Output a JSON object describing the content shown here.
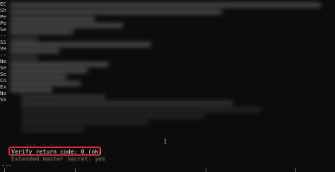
{
  "left_prefixes": [
    "EC",
    "Sh",
    "Pe",
    "Pe",
    "Se",
    "--",
    "SS",
    "Ve",
    "--",
    "Ne",
    "Se",
    "Se",
    "Co",
    "Ex",
    "No",
    "SS"
  ],
  "bottom_lines": {
    "faded_above": "    ---  · · ·  ",
    "verify": "Verify return code: 0 (ok)",
    "faded_below": "Extended master secret: yes"
  },
  "prompt_dashes": "---",
  "cursor_glyph": "I",
  "colors": {
    "background": "#0c0c0c",
    "highlight_border": "#e0262b",
    "text": "#d4d4d4"
  }
}
